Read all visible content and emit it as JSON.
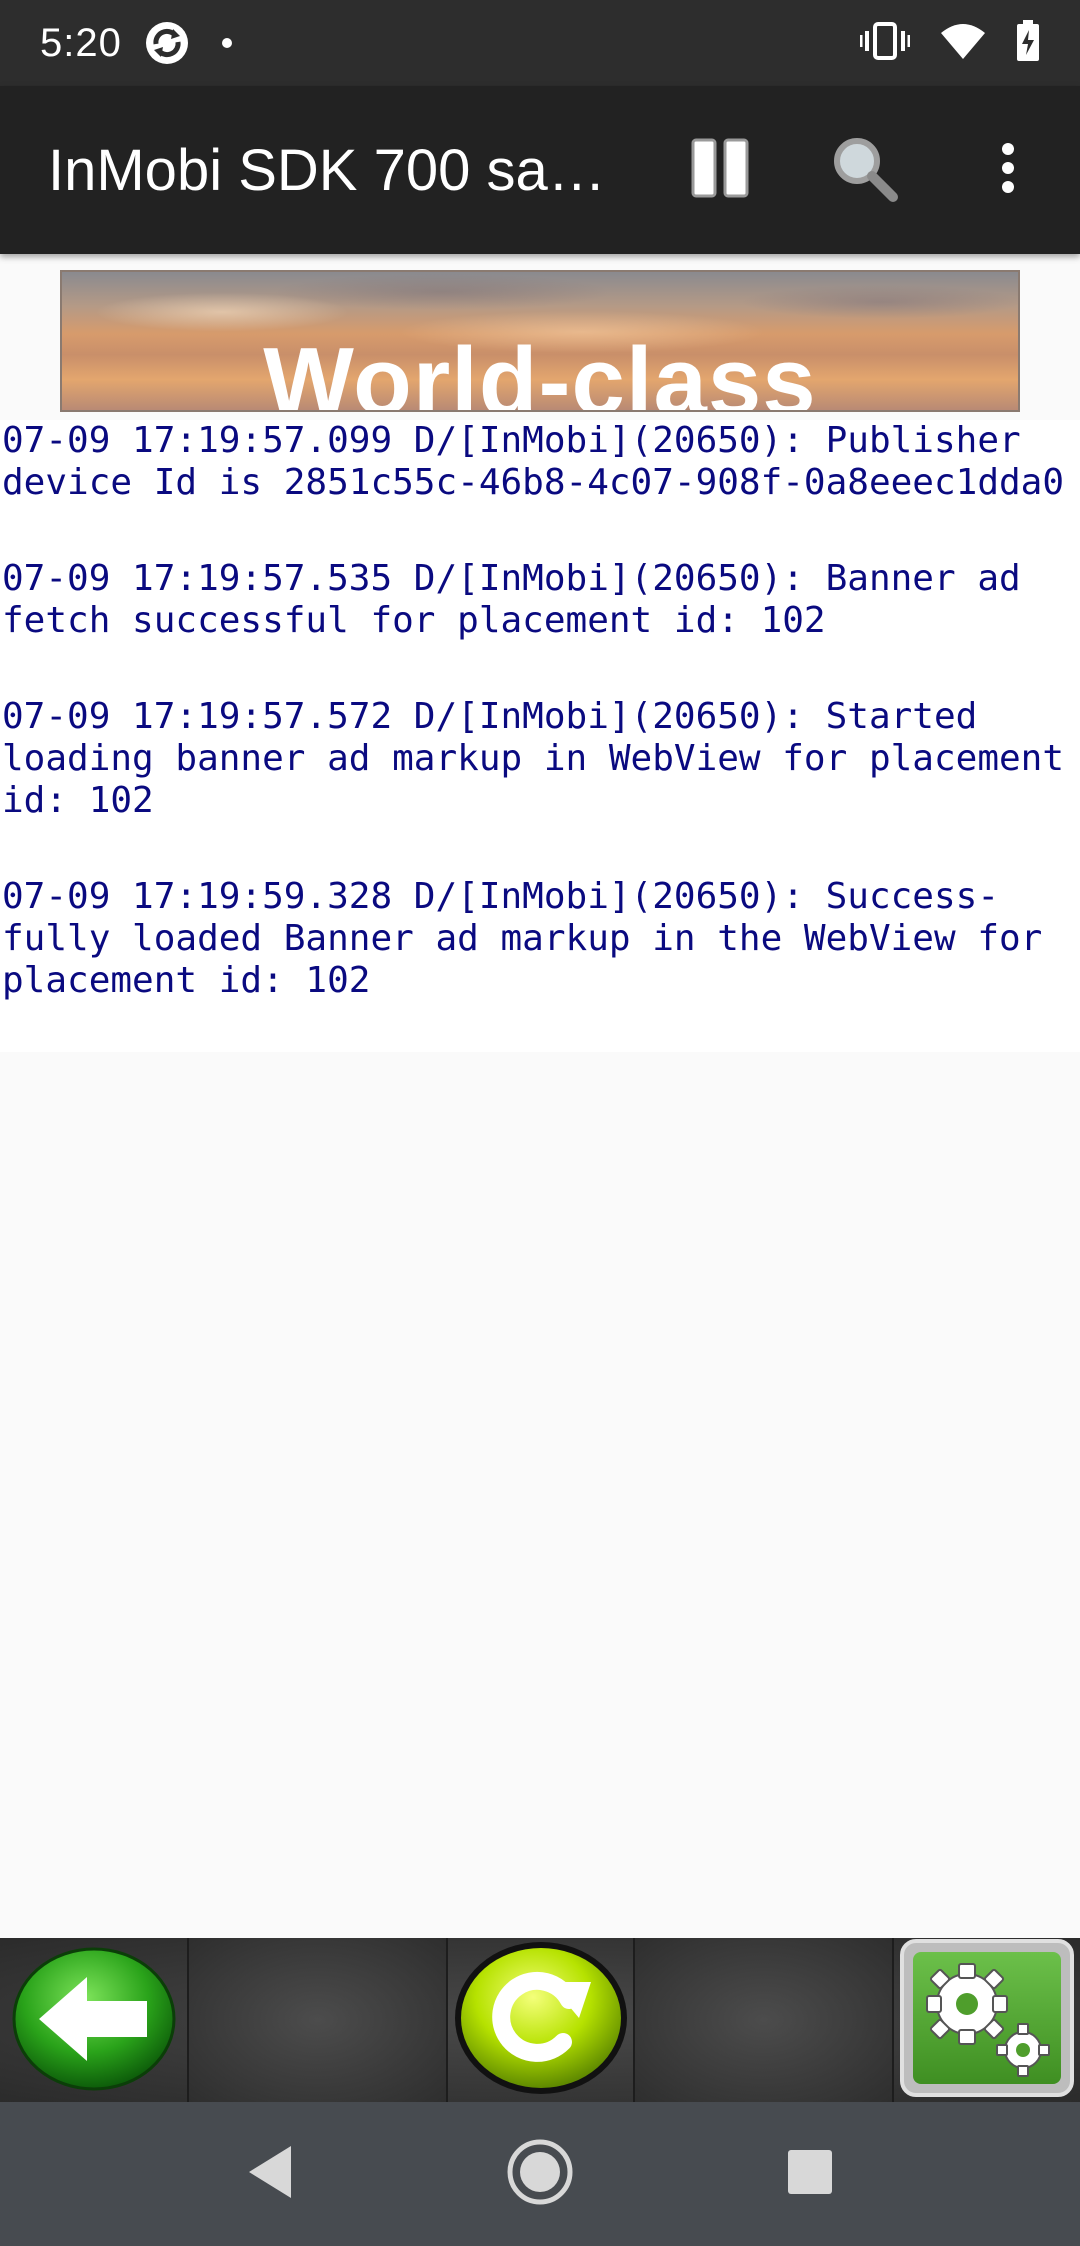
{
  "status_bar": {
    "time": "5:20"
  },
  "app_bar": {
    "title": "InMobi SDK 700 sa…",
    "actions": [
      "pause-icon",
      "search-icon",
      "more-vert-icon"
    ]
  },
  "banner": {
    "text": "World-class"
  },
  "log": {
    "entries": [
      "07-09 17:19:57.099 D/[InMobi](20650): Publisher device Id is 2851c55c-46b8-4c07-908f-0a8eeec1dda0",
      "07-09 17:19:57.535 D/[InMobi](20650): Banner ad fetch successful for placement id: 102",
      "07-09 17:19:57.572 D/[InMobi](20650): Started loading banner ad markup in WebView for placement id: 102",
      "07-09 17:19:59.328 D/[InMobi](20650): Success-fully loaded Banner ad markup in the WebView for placement id: 102"
    ],
    "text_color": "#0a0a80"
  },
  "toolbar": {
    "buttons": [
      "back-arrow-icon",
      "refresh-icon",
      "settings-gears-icon"
    ]
  },
  "nav_bar": {
    "buttons": [
      "back-icon",
      "home-icon",
      "recents-icon"
    ]
  },
  "colors": {
    "app_bar": "#222222",
    "status_bar": "#2d2d2d",
    "nav_bar": "#474b50",
    "background": "#fafafa"
  }
}
